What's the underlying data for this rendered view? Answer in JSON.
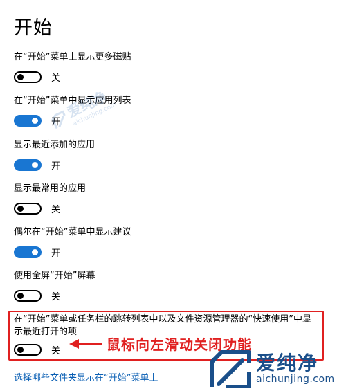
{
  "page": {
    "title": "开始"
  },
  "settings": [
    {
      "label": "在“开始”菜单上显示更多磁贴",
      "state": "关",
      "on": false
    },
    {
      "label": "在“开始”菜单中显示应用列表",
      "state": "开",
      "on": true
    },
    {
      "label": "显示最近添加的应用",
      "state": "开",
      "on": true
    },
    {
      "label": "显示最常用的应用",
      "state": "关",
      "on": false
    },
    {
      "label": "偶尔在“开始”菜单中显示建议",
      "state": "开",
      "on": true
    },
    {
      "label": "使用全屏“开始”屏幕",
      "state": "关",
      "on": false
    },
    {
      "label": "在“开始”菜单或任务栏的跳转列表中以及文件资源管理器的“快速使用”中显示最近打开的项",
      "state": "关",
      "on": false
    }
  ],
  "annotation": {
    "text": "鼠标向左滑动关闭功能",
    "color": "#e02020"
  },
  "link": {
    "label": "选择哪些文件夹显示在“开始”菜单上"
  },
  "watermark": {
    "cn": "爱纯净",
    "en": "aichunjing.com"
  },
  "colors": {
    "accent": "#1976d2",
    "link": "#0a5fb4",
    "highlight": "#e02020"
  }
}
